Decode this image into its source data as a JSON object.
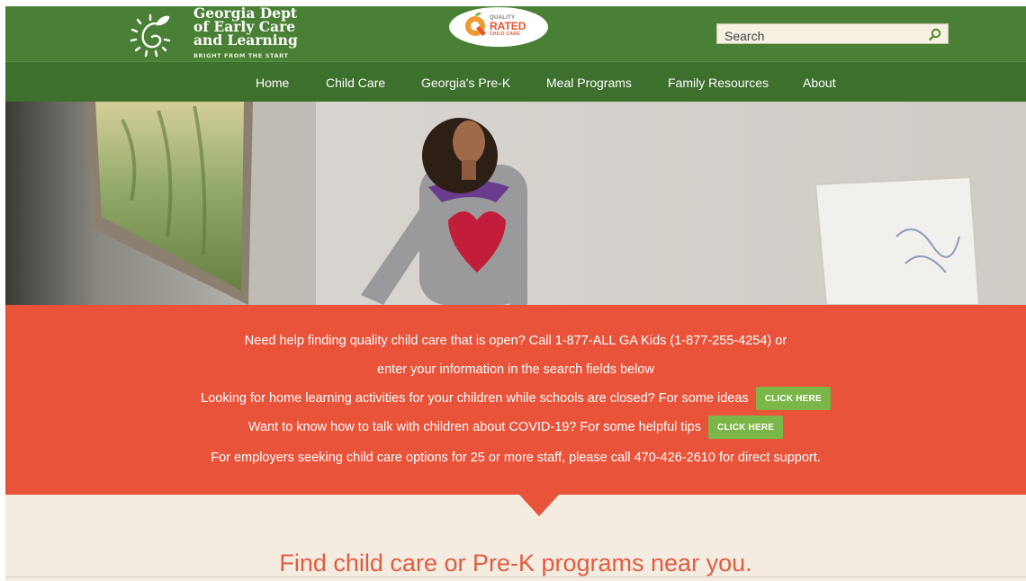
{
  "header": {
    "logo": {
      "lines": [
        "Georgia Dept",
        "of Early Care",
        "and Learning"
      ],
      "tagline": "BRIGHT FROM THE START"
    },
    "quality_badge": {
      "small": "QUALITY",
      "big": "RATED",
      "sub": "CHILD CARE"
    },
    "search": {
      "placeholder": "Search",
      "icon": "search-icon"
    }
  },
  "nav": {
    "items": [
      {
        "label": "Home"
      },
      {
        "label": "Child Care"
      },
      {
        "label": "Georgia's Pre-K"
      },
      {
        "label": "Meal Programs"
      },
      {
        "label": "Family Resources"
      },
      {
        "label": "About"
      }
    ]
  },
  "banner": {
    "line1": "Need help finding quality child care that is open? Call 1-877-ALL GA Kids (1-877-255-4254) or",
    "line2": "enter your information in the search fields below",
    "line3": "Looking for home learning activities for your children while schools are closed? For some ideas",
    "line3_button": "CLICK HERE",
    "line4": "Want to know how to talk with children about COVID-19? For some helpful tips",
    "line4_button": "CLICK HERE",
    "line5": "For employers seeking child care options for 25 or more staff, please call 470-426-2610 for direct support."
  },
  "find": {
    "title": "Find child care or Pre-K programs near you."
  },
  "colors": {
    "header_green": "#4a8035",
    "nav_green": "#3d6f2d",
    "banner_red": "#e8533a",
    "cta_green": "#7ab648",
    "find_bg": "#f4ebe1",
    "find_title": "#e05d3f"
  }
}
